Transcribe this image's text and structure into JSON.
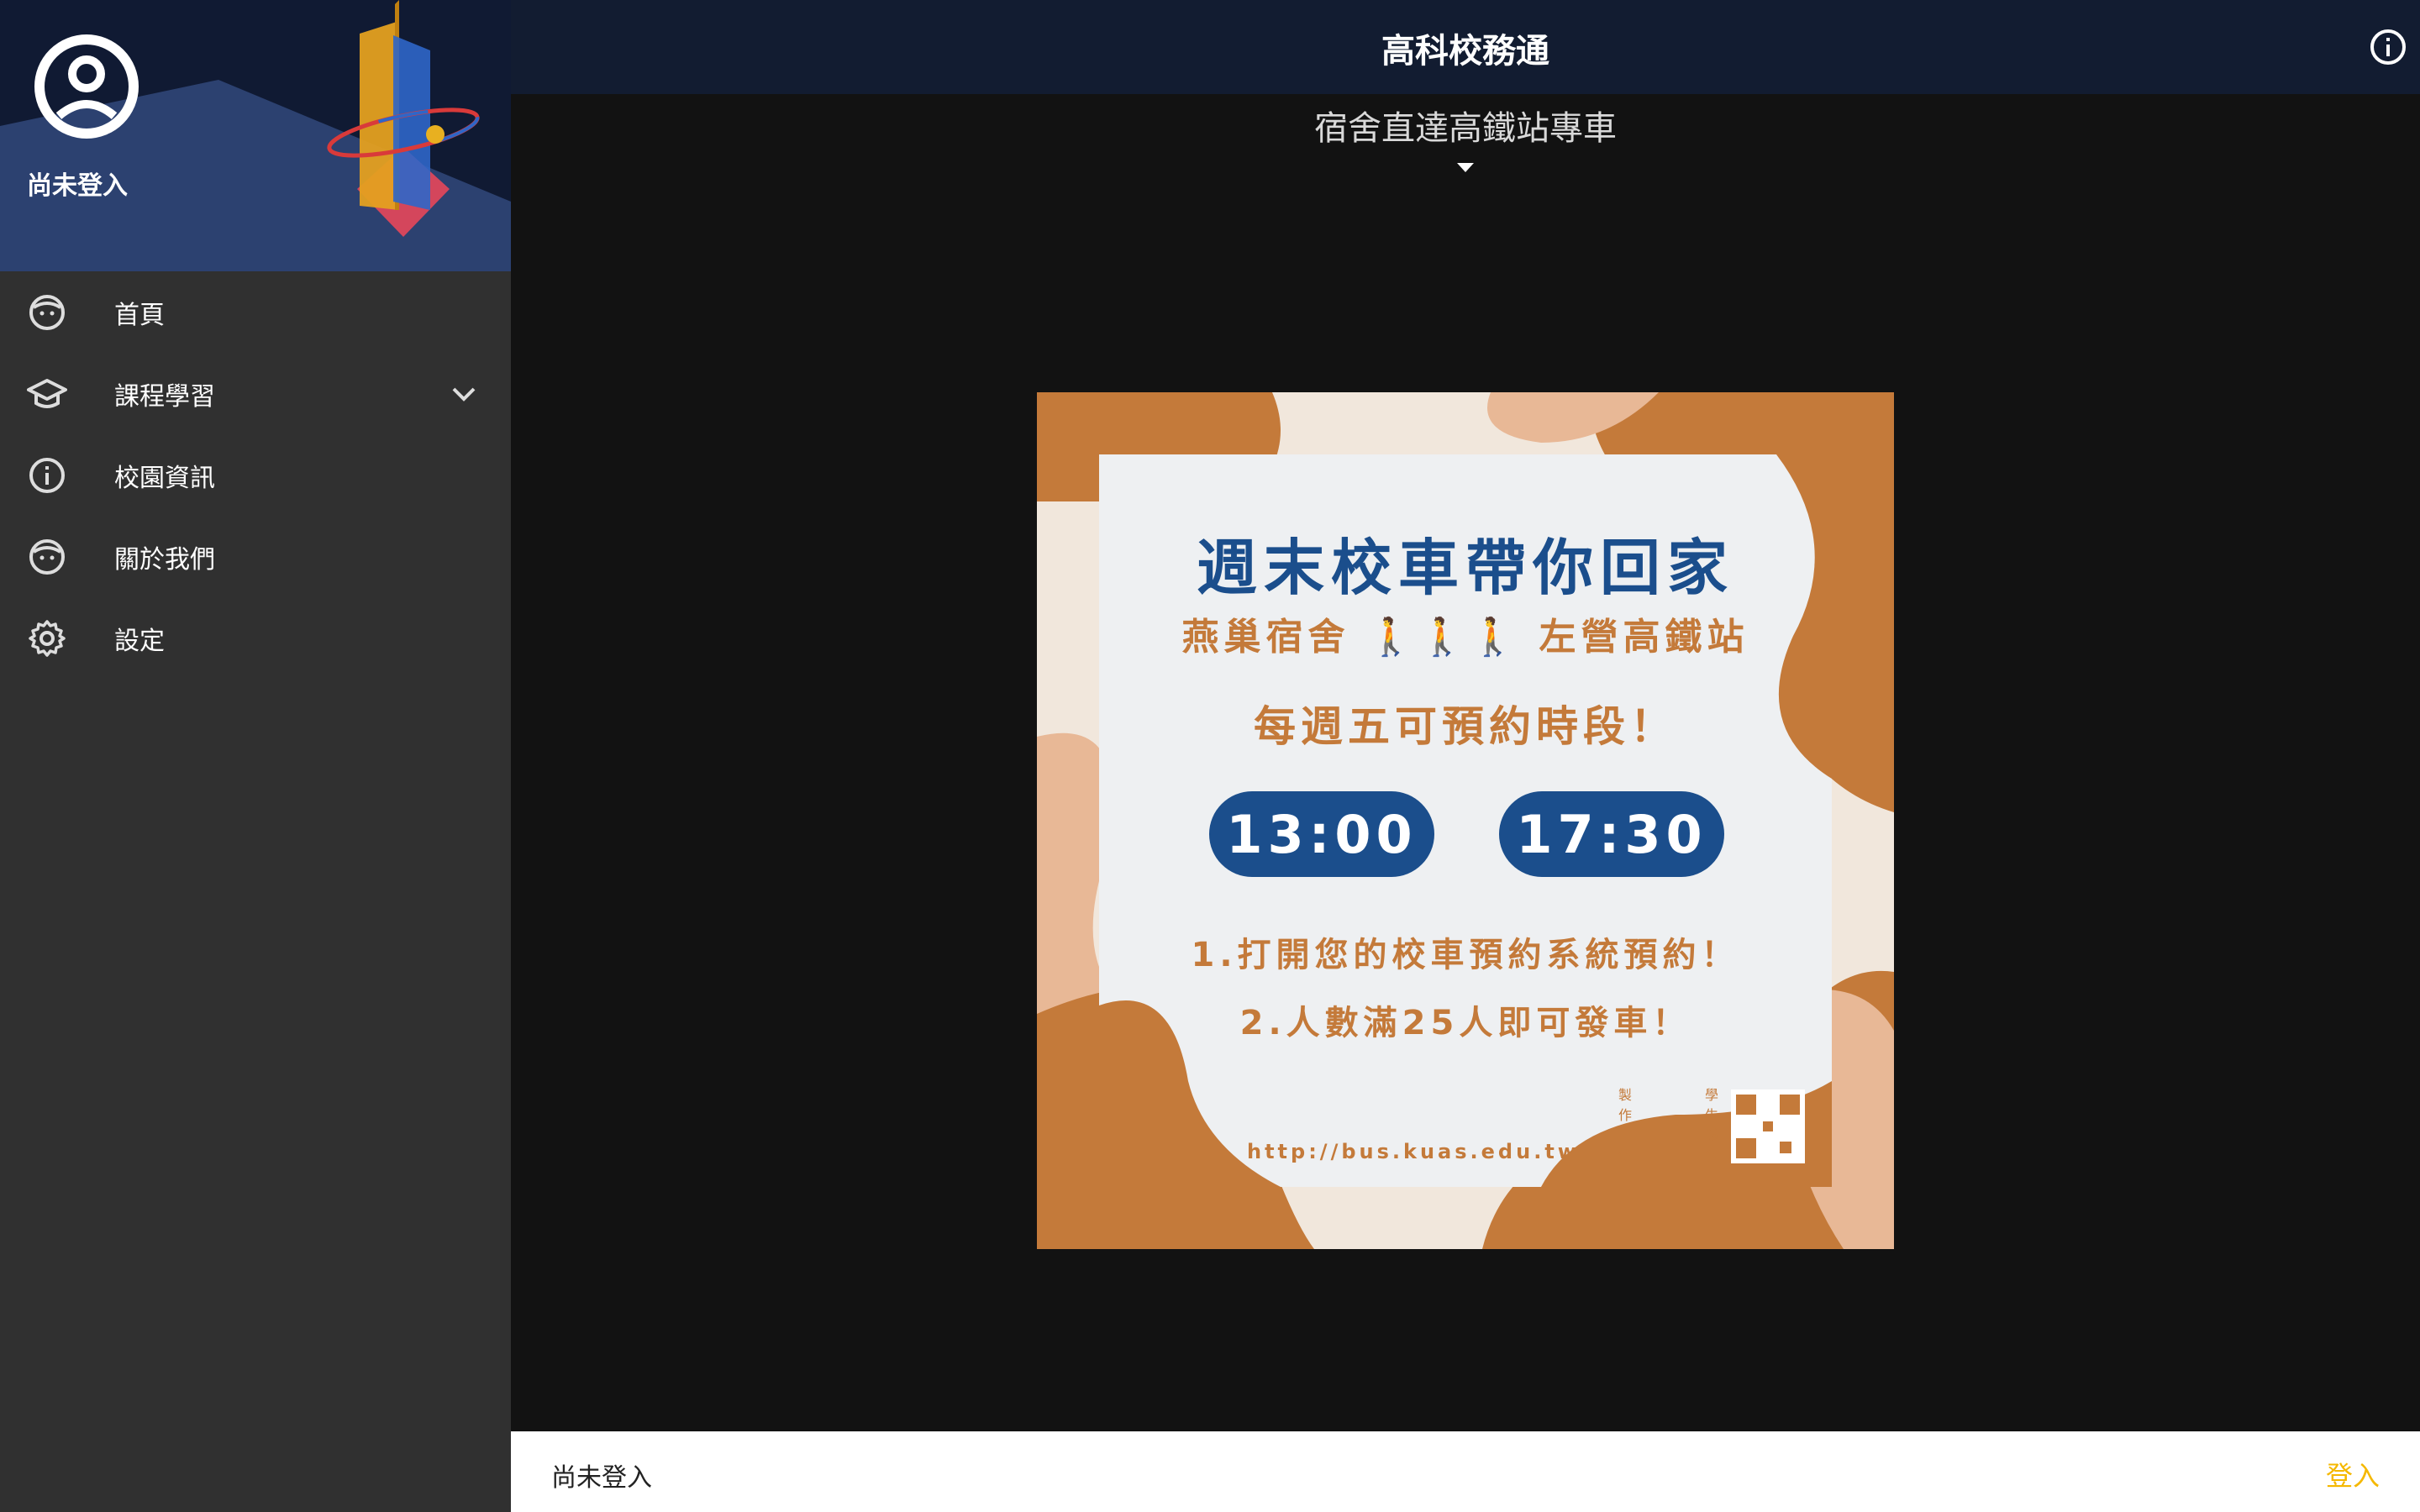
{
  "drawer": {
    "user_status": "尚未登入",
    "items": [
      {
        "label": "首頁",
        "icon": "face-icon"
      },
      {
        "label": "課程學習",
        "icon": "school-icon"
      },
      {
        "label": "校園資訊",
        "icon": "info-icon"
      },
      {
        "label": "關於我們",
        "icon": "face-icon"
      },
      {
        "label": "設定",
        "icon": "gear-icon"
      }
    ]
  },
  "appbar": {
    "title": "高科校務通"
  },
  "content": {
    "subtitle": "宿舍直達高鐵站專車",
    "poster": {
      "headline": "週末校車帶你回家",
      "route_from": "燕巢宿舍",
      "route_to": "左營高鐵站",
      "booking": "每週五可預約時段！",
      "time1": "13:00",
      "time2": "17:30",
      "step1": "1.打開您的校車預約系統預約！",
      "step2": "2.人數滿25人即可發車！",
      "url": "http://bus.kuas.edu.tw",
      "credit_left": "製作宣傳",
      "credit_right": "學生議會"
    }
  },
  "bottombar": {
    "status": "尚未登入",
    "login": "登入"
  },
  "colors": {
    "accent": "#f5b800",
    "poster_orange": "#c47a3a",
    "poster_blue": "#1b4e8c"
  }
}
